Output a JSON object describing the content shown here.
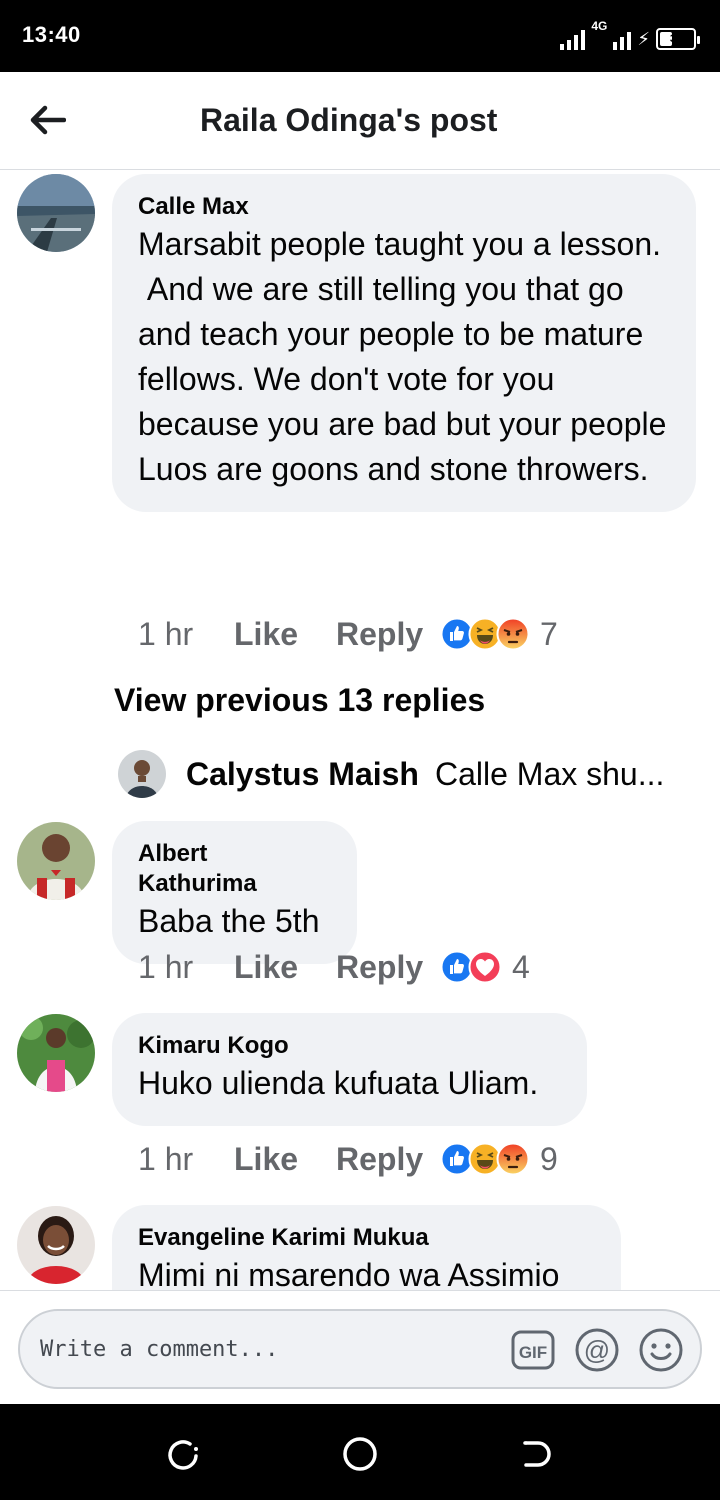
{
  "status_bar": {
    "time": "13:40",
    "network": "4G",
    "battery": "39",
    "battery_fraction": 0.39
  },
  "header": {
    "title": "Raila Odinga's post"
  },
  "comments": [
    {
      "author": "Calle Max",
      "text": "Marsabit people taught you a lesson.\n And we are still telling you that go and teach your people to be mature fellows. We don't vote for you because you are bad but your people Luos are goons and stone throwers.",
      "time": "1 hr",
      "like": "Like",
      "reply": "Reply",
      "reactions": [
        "like",
        "haha",
        "angry"
      ],
      "reaction_count": "7"
    },
    {
      "author": "Albert Kathurima",
      "text": "Baba the 5th",
      "time": "1 hr",
      "like": "Like",
      "reply": "Reply",
      "reactions": [
        "like",
        "love"
      ],
      "reaction_count": "4"
    },
    {
      "author": "Kimaru Kogo",
      "text": "Huko ulienda kufuata Uliam.",
      "time": "1 hr",
      "like": "Like",
      "reply": "Reply",
      "reactions": [
        "like",
        "haha",
        "angry"
      ],
      "reaction_count": "9"
    },
    {
      "author": "Evangeline Karimi Mukua",
      "text": "Mimi ni msarendo wa Assimio"
    }
  ],
  "replies_thread": {
    "view_previous": "View previous 13 replies",
    "preview_author": "Calystus Maish",
    "preview_text": "Calle Max shu..."
  },
  "composer": {
    "placeholder": "Write a comment...",
    "gif_label": "GIF"
  },
  "colors": {
    "like_blue": "#1877f2",
    "love_red": "#f33e58",
    "reaction_yellow": "#f7b125",
    "angry_orange": "#e9710f",
    "bubble_bg": "#f0f2f5",
    "meta_gray": "#65676b"
  }
}
